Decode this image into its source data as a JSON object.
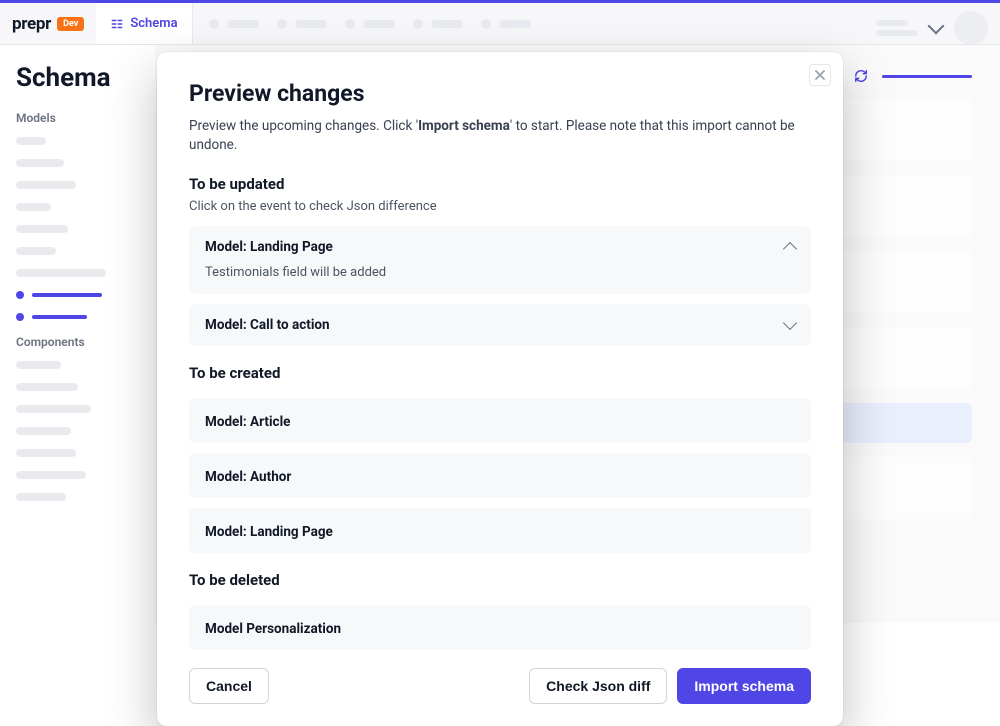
{
  "header": {
    "logo": "prepr",
    "badge": "Dev",
    "tab_label": "Schema"
  },
  "sidebar": {
    "title": "Schema",
    "section_models": "Models",
    "section_components": "Components"
  },
  "modal": {
    "title": "Preview changes",
    "subtitle_prefix": "Preview the upcoming changes. Click '",
    "subtitle_bold": "Import schema",
    "subtitle_suffix": "' to start. Please note that this import cannot be undone.",
    "updated": {
      "heading": "To be updated",
      "sub": "Click on the event to check Json difference",
      "items": [
        {
          "title": "Model: Landing Page",
          "expanded": true,
          "detail": "Testimonials field will be added"
        },
        {
          "title": "Model: Call to action",
          "expanded": false
        }
      ]
    },
    "created": {
      "heading": "To be created",
      "items": [
        {
          "title": "Model: Article"
        },
        {
          "title": "Model: Author"
        },
        {
          "title": "Model: Landing Page"
        }
      ]
    },
    "deleted": {
      "heading": "To be deleted",
      "items": [
        {
          "title": "Model Personalization"
        }
      ]
    },
    "buttons": {
      "cancel": "Cancel",
      "check_diff": "Check Json diff",
      "import": "Import schema"
    }
  }
}
